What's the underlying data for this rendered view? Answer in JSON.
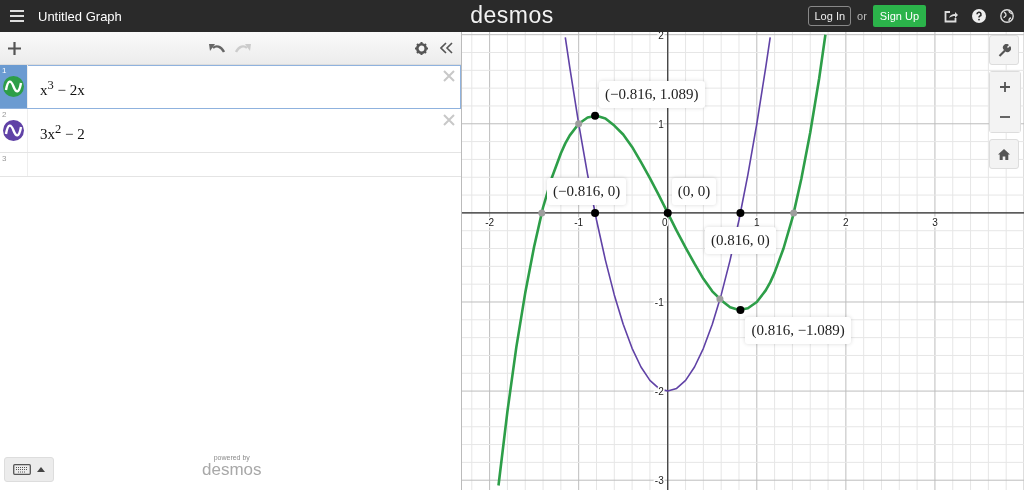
{
  "header": {
    "title": "Untitled Graph",
    "logo": "desmos",
    "login": "Log In",
    "or": "or",
    "signup": "Sign Up"
  },
  "expressions": [
    {
      "kind": "expression",
      "number": "1",
      "latex": "x$^{3}$ − 2x",
      "color": "#2d9e48",
      "selected": true
    },
    {
      "kind": "expression",
      "number": "2",
      "latex": "3x$^{2}$ − 2",
      "color": "#6042a6",
      "selected": false
    },
    {
      "kind": "empty",
      "number": "3",
      "selected": false
    }
  ],
  "footer": {
    "powered_by": "powered by",
    "brand": "desmos"
  },
  "graph": {
    "chart_data": {
      "type": "line",
      "xlim": [
        -2.31,
        4.0
      ],
      "ylim": [
        -3.11,
        2.03
      ],
      "xticks": [
        -2,
        -1,
        0,
        1,
        2,
        3
      ],
      "yticks": [
        -3,
        -2,
        -1,
        1,
        2
      ],
      "grid": true,
      "x": [
        -1.9,
        -1.8,
        -1.7,
        -1.6,
        -1.5,
        -1.414,
        -1.4,
        -1.3,
        -1.2,
        -1.15,
        -1.1,
        -1.0,
        -0.9,
        -0.8,
        -0.7,
        -0.6,
        -0.5,
        -0.4,
        -0.3,
        -0.2,
        -0.1,
        0,
        0.1,
        0.2,
        0.3,
        0.4,
        0.5,
        0.6,
        0.7,
        0.8,
        0.9,
        1.0,
        1.1,
        1.15,
        1.2,
        1.3,
        1.4,
        1.414,
        1.5,
        1.6,
        1.7,
        1.77
      ],
      "series": [
        {
          "color": "#2d9e48",
          "values": [
            -3.06,
            -2.23,
            -1.51,
            -0.9,
            -0.38,
            0,
            0.06,
            0.4,
            0.67,
            0.78,
            0.87,
            1,
            1.07,
            1.09,
            1.06,
            0.98,
            0.88,
            0.74,
            0.57,
            0.39,
            0.2,
            0,
            -0.2,
            -0.39,
            -0.57,
            -0.74,
            -0.88,
            -0.98,
            -1.06,
            -1.09,
            -1.07,
            -1,
            -0.87,
            -0.78,
            -0.67,
            -0.4,
            -0.06,
            0,
            0.38,
            0.9,
            1.51,
            2.0
          ]
        },
        {
          "color": "#6042a6",
          "values": [
            null,
            null,
            null,
            null,
            null,
            null,
            null,
            null,
            null,
            1.97,
            1.63,
            1,
            0.43,
            -0.08,
            -0.53,
            -0.92,
            -1.25,
            -1.52,
            -1.73,
            -1.88,
            -1.97,
            -2,
            -1.97,
            -1.88,
            -1.73,
            -1.52,
            -1.25,
            -0.92,
            -0.53,
            -0.08,
            0.43,
            1,
            1.63,
            1.97,
            null,
            null,
            null,
            null,
            null,
            null,
            null,
            null
          ]
        }
      ],
      "annotations": [
        {
          "x": -0.816,
          "y": 1.089,
          "text": "(−0.816, 1.089)"
        },
        {
          "x": -0.816,
          "y": 0,
          "text": "(−0.816, 0)"
        },
        {
          "x": 0,
          "y": 0,
          "text": "(0, 0)"
        },
        {
          "x": 0.816,
          "y": 0,
          "text": "(0.816, 0)"
        },
        {
          "x": 0.816,
          "y": -1.089,
          "text": "(0.816, −1.089)"
        }
      ]
    }
  }
}
